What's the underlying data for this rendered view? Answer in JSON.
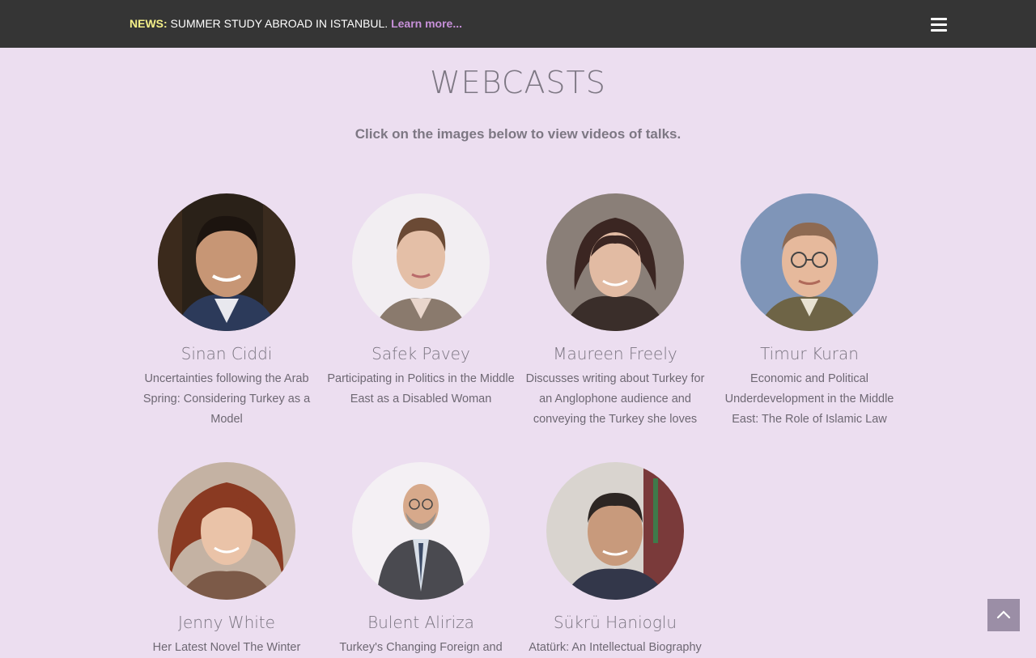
{
  "news": {
    "label": "NEWS:",
    "text": " SUMMER STUDY ABROAD IN ISTANBUL. ",
    "link": "Learn more..."
  },
  "page": {
    "title": "WEBCASTS",
    "subtitle": "Click on the images below to view videos of talks."
  },
  "speakers": [
    {
      "name": "Sinan Ciddi",
      "desc": "Uncertainties following the Arab Spring: Considering Turkey as a Model"
    },
    {
      "name": "Safek Pavey",
      "desc": "Participating in Politics in the Middle East as a Disabled Woman"
    },
    {
      "name": "Maureen Freely",
      "desc": "Discusses writing about Turkey for an Anglophone audience and conveying the Turkey she loves"
    },
    {
      "name": "Timur Kuran",
      "desc": "Economic and Political Underdevelopment in the Middle East: The Role of Islamic Law"
    },
    {
      "name": "Jenny White",
      "desc": "Her Latest Novel The Winter"
    },
    {
      "name": "Bulent Aliriza",
      "desc": "Turkey's Changing Foreign and"
    },
    {
      "name": "Sükrü Hanioglu",
      "desc": "Atatürk: An Intellectual Biography"
    }
  ],
  "icons": {
    "menu": "hamburger-menu-icon",
    "to_top": "chevron-up-icon"
  },
  "colors": {
    "topbar": "#353535",
    "background": "#ecdef0",
    "news_label": "#f5f089",
    "link": "#c790d9",
    "to_top": "#9b8ea6"
  }
}
